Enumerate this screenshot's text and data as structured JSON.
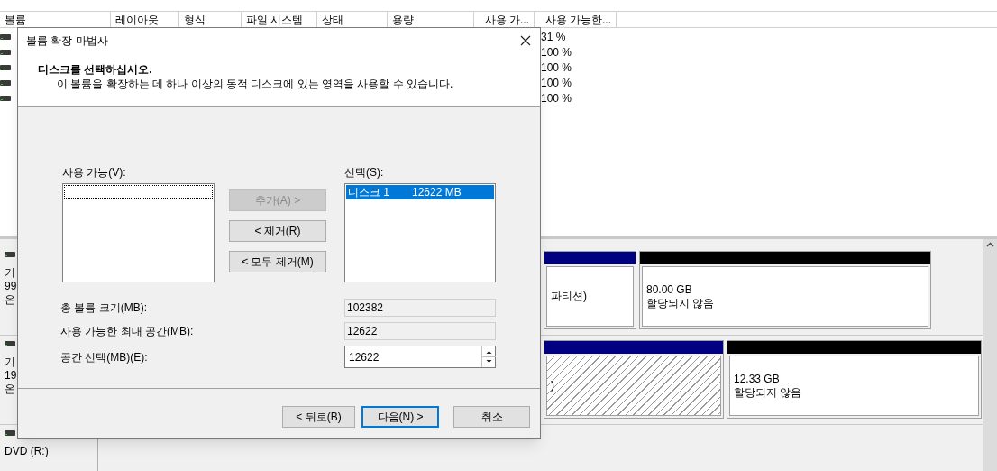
{
  "volume_list": {
    "columns": [
      "볼륨",
      "레이아웃",
      "형식",
      "파일 시스템",
      "상태",
      "용량",
      "사용 가...",
      "사용 가능한..."
    ],
    "rows": [
      {
        "free_percent": "31 %"
      },
      {
        "free_percent": "100 %"
      },
      {
        "free_percent": "100 %"
      },
      {
        "free_percent": "100 %"
      },
      {
        "free_percent": "100 %"
      }
    ]
  },
  "disks": [
    {
      "label_lines": [
        "기",
        "99",
        "온"
      ],
      "partitions": [
        {
          "kind": "primary",
          "text_lines": [
            "파티션)"
          ]
        },
        {
          "kind": "unallocated",
          "text_lines": [
            "80.00 GB",
            "할당되지 않음"
          ]
        }
      ]
    },
    {
      "label_lines": [
        "기",
        "19",
        "온"
      ],
      "partitions": [
        {
          "kind": "selected",
          "text_lines": [
            ")"
          ]
        },
        {
          "kind": "unallocated",
          "text_lines": [
            "12.33 GB",
            "할당되지 않음"
          ]
        }
      ]
    },
    {
      "label_lines": [
        "DVD (R:)"
      ]
    }
  ],
  "dialog": {
    "title": "볼륨 확장 마법사",
    "heading": "디스크를 선택하십시오.",
    "subtitle": "이 볼륨을 확장하는 데 하나 이상의 동적 디스크에 있는 영역을 사용할 수 있습니다.",
    "available_label": "사용 가능(V):",
    "selected_label": "선택(S):",
    "selected_items": [
      {
        "disk": "디스크 1",
        "size": "12622 MB",
        "selected": true
      }
    ],
    "move_buttons": [
      {
        "label": "추가(A) >",
        "disabled": true
      },
      {
        "label": "< 제거(R)",
        "disabled": false
      },
      {
        "label": "< 모두 제거(M)",
        "disabled": false
      }
    ],
    "fields": [
      {
        "label": "총 볼륨 크기(MB):",
        "value": "102382",
        "kind": "readonly"
      },
      {
        "label": "사용 가능한 최대 공간(MB):",
        "value": "12622",
        "kind": "readonly"
      },
      {
        "label": "공간 선택(MB)(E):",
        "value": "12622",
        "kind": "spinner"
      }
    ],
    "buttons": [
      {
        "label": "< 뒤로(B)",
        "default": false
      },
      {
        "label": "다음(N) >",
        "default": true
      },
      {
        "label": "취소",
        "default": false
      }
    ]
  }
}
